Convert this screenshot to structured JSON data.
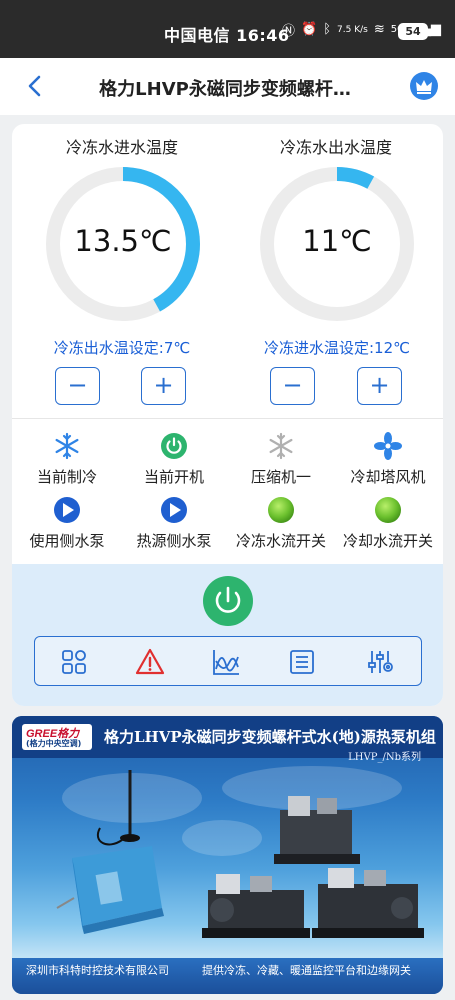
{
  "status_bar": {
    "carrier_time": "中国电信 16:46",
    "speed": "7.5 K/s",
    "network": "5G",
    "battery": "54"
  },
  "nav": {
    "title": "格力LHVP永磁同步变频螺杆…"
  },
  "gauges": [
    {
      "title": "冷冻水进水温度",
      "value": "13.5℃",
      "fill_fraction": 0.42,
      "setpoint": "冷冻出水温设定:7℃"
    },
    {
      "title": "冷冻水出水温度",
      "value": "11℃",
      "fill_fraction": 0.08,
      "setpoint": "冷冻进水温设定:12℃"
    }
  ],
  "stepper": {
    "minus": "−",
    "plus": "+"
  },
  "status_items": [
    {
      "label": "当前制冷",
      "icon": "snowflake-icon",
      "color": "#2f84e6"
    },
    {
      "label": "当前开机",
      "icon": "power-icon",
      "color": "#2db46e"
    },
    {
      "label": "压缩机一",
      "icon": "snowflake-icon",
      "color": "#b0b0b0"
    },
    {
      "label": "冷却塔风机",
      "icon": "fan-icon",
      "color": "#2f84e6"
    },
    {
      "label": "使用侧水泵",
      "icon": "pump-icon",
      "color": "#1f5fd0"
    },
    {
      "label": "热源侧水泵",
      "icon": "pump-icon",
      "color": "#1f5fd0"
    },
    {
      "label": "冷冻水流开关",
      "icon": "green-ball-icon",
      "color": "#6cc12e"
    },
    {
      "label": "冷却水流开关",
      "icon": "green-ball-icon",
      "color": "#6cc12e"
    }
  ],
  "toolbar": [
    {
      "icon": "grid-icon"
    },
    {
      "icon": "alarm-warning-icon"
    },
    {
      "icon": "trend-chart-icon"
    },
    {
      "icon": "list-icon"
    },
    {
      "icon": "settings-sliders-icon"
    }
  ],
  "banner": {
    "logo_text": "GREE格力",
    "logo_sub": "(格力中央空调)",
    "title": "格力LHVP永磁同步变频螺杆式水(地)源热泵机组",
    "series": "LHVP_/Nb系列",
    "footer_left": "深圳市科特时控技术有限公司",
    "footer_right": "提供冷冻、冷藏、暖通监控平台和边缘网关"
  },
  "colors": {
    "accent": "#2f84e6",
    "gauge_arc": "#35b6f0",
    "gauge_track": "#ececec",
    "setpoint_text": "#1a5fd6"
  }
}
